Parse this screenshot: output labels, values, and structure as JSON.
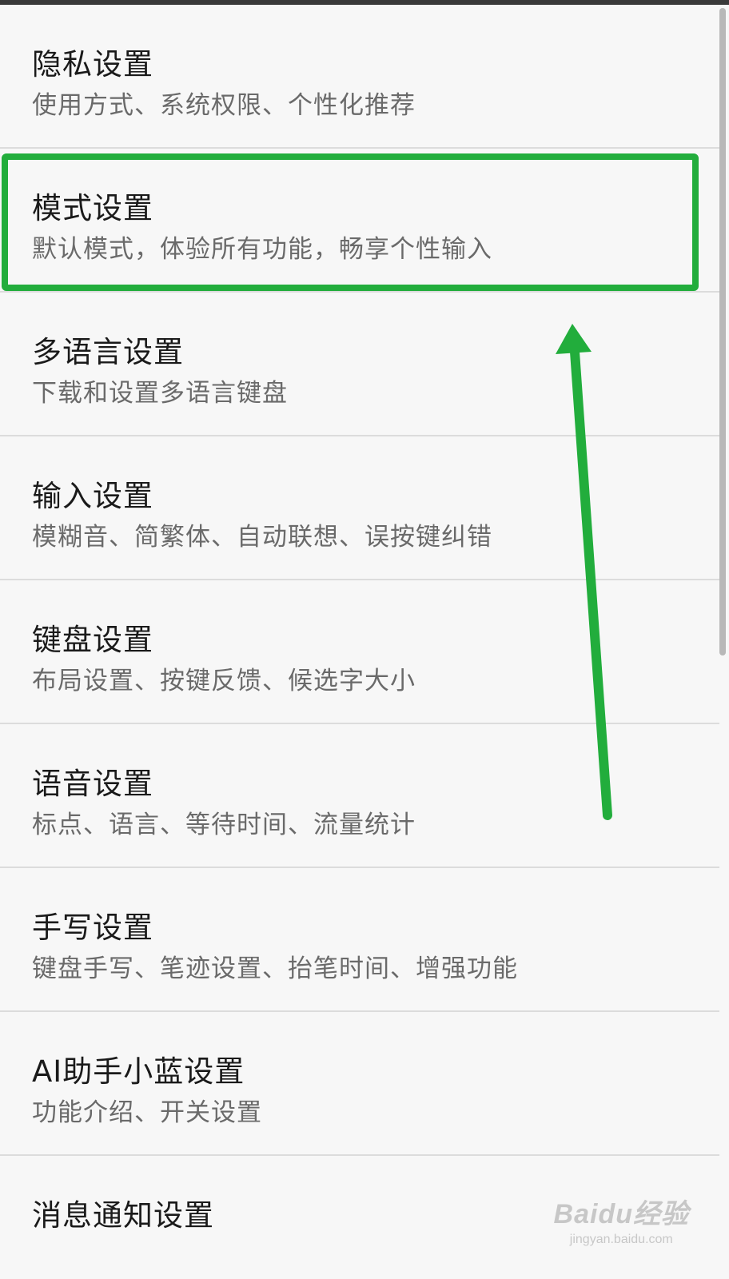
{
  "settings": {
    "items": [
      {
        "title": "隐私设置",
        "subtitle": "使用方式、系统权限、个性化推荐"
      },
      {
        "title": "模式设置",
        "subtitle": "默认模式，体验所有功能，畅享个性输入"
      },
      {
        "title": "多语言设置",
        "subtitle": "下载和设置多语言键盘"
      },
      {
        "title": "输入设置",
        "subtitle": "模糊音、简繁体、自动联想、误按键纠错"
      },
      {
        "title": "键盘设置",
        "subtitle": "布局设置、按键反馈、候选字大小"
      },
      {
        "title": "语音设置",
        "subtitle": "标点、语言、等待时间、流量统计"
      },
      {
        "title": "手写设置",
        "subtitle": "键盘手写、笔迹设置、抬笔时间、增强功能"
      },
      {
        "title": "AI助手小蓝设置",
        "subtitle": "功能介绍、开关设置"
      },
      {
        "title": "消息通知设置",
        "subtitle": ""
      }
    ]
  },
  "annotation": {
    "highlight_color": "#22ad3c",
    "highlighted_item": "模式设置"
  },
  "watermark": {
    "brand": "Baidu经验",
    "url": "jingyan.baidu.com"
  }
}
